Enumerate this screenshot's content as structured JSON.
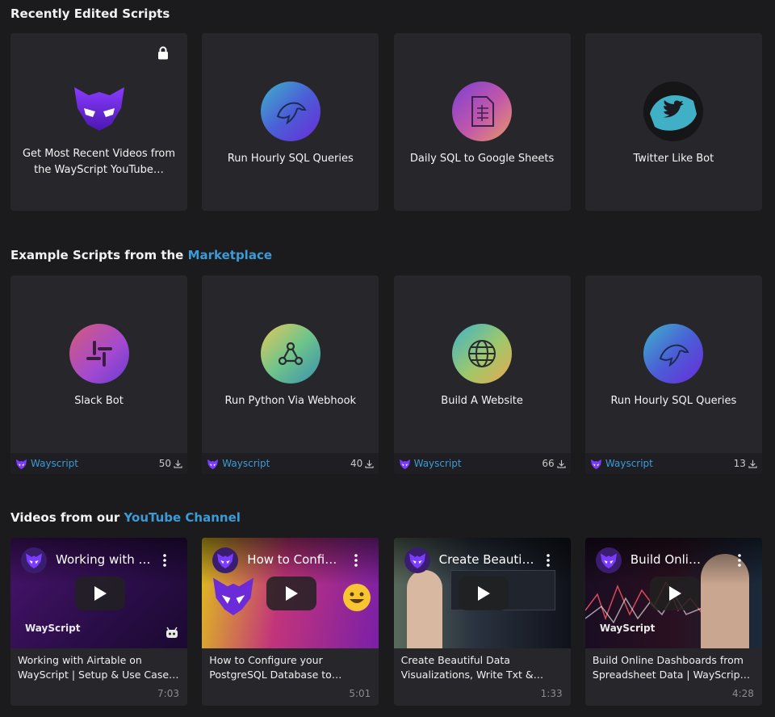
{
  "sections": {
    "recent": {
      "title": "Recently Edited Scripts"
    },
    "marketplace": {
      "title_prefix": "Example Scripts from the ",
      "title_link": "Marketplace"
    },
    "videos": {
      "title_prefix": "Videos from our ",
      "title_link": "YouTube Channel"
    }
  },
  "colors": {
    "background": "#1b1b1e",
    "card": "#27262b",
    "link": "#3c9bd7",
    "brand_purple": "#6b2bd9"
  },
  "recent_scripts": [
    {
      "title": "Get Most Recent Videos from the WayScript YouTube…",
      "icon": "wayscript-mask-icon",
      "locked": true
    },
    {
      "title": "Run Hourly SQL Queries",
      "icon": "mysql-dolphin-icon"
    },
    {
      "title": "Daily SQL to Google Sheets",
      "icon": "google-sheets-icon"
    },
    {
      "title": "Twitter Like Bot",
      "icon": "twitter-bird-icon"
    }
  ],
  "marketplace_scripts": [
    {
      "title": "Slack Bot",
      "icon": "slack-icon",
      "author": "Wayscript",
      "downloads": "50"
    },
    {
      "title": "Run Python Via Webhook",
      "icon": "webhook-icon",
      "author": "Wayscript",
      "downloads": "40"
    },
    {
      "title": "Build A Website",
      "icon": "globe-icon",
      "author": "Wayscript",
      "downloads": "66"
    },
    {
      "title": "Run Hourly SQL Queries",
      "icon": "mysql-dolphin-icon",
      "author": "Wayscript",
      "downloads": "13"
    }
  ],
  "videos": [
    {
      "thumb_title": "Working with Airtable",
      "description": "Working with Airtable on WayScript | Setup & Use Case…",
      "duration": "7:03",
      "watermark": "WayScript"
    },
    {
      "thumb_title": "How to Configure your PostgreSQL",
      "description": "How to Configure your PostgreSQL Database to WayScript | Databas…",
      "duration": "5:01"
    },
    {
      "thumb_title": "Create Beautiful Data",
      "description": "Create Beautiful Data Visualizations, Write Txt & JSON…",
      "duration": "1:33"
    },
    {
      "thumb_title": "Build Online Dashboards",
      "description": "Build Online Dashboards from Spreadsheet Data | WayScript for…",
      "duration": "4:28",
      "watermark": "WayScript"
    }
  ]
}
